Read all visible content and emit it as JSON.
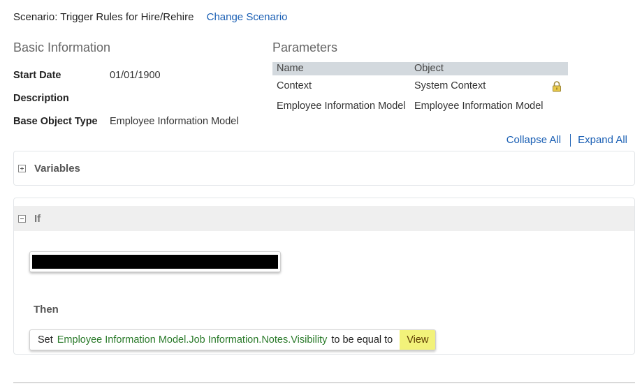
{
  "scenario": {
    "label": "Scenario: Trigger Rules for Hire/Rehire",
    "change_link": "Change Scenario"
  },
  "basic_info": {
    "title": "Basic Information",
    "rows": [
      {
        "label": "Start Date",
        "value": "01/01/1900"
      },
      {
        "label": "Description",
        "value": ""
      },
      {
        "label": "Base Object Type",
        "value": "Employee Information Model"
      }
    ]
  },
  "parameters": {
    "title": "Parameters",
    "headers": [
      "Name",
      "Object"
    ],
    "rows": [
      {
        "name": "Context",
        "object": "System Context",
        "locked": true
      },
      {
        "name": "Employee Information Model",
        "object": "Employee Information Model",
        "locked": false
      }
    ]
  },
  "expand_controls": {
    "collapse": "Collapse All",
    "expand": "Expand All"
  },
  "variables_panel": {
    "title": "Variables"
  },
  "if_panel": {
    "title": "If",
    "then_label": "Then",
    "set_statement": {
      "keyword": "Set",
      "field": "Employee Information Model.Job Information.Notes.Visibility",
      "operator": "to be equal to",
      "value": "View"
    }
  },
  "colors": {
    "link": "#1a5fb4",
    "field": "#2a7a2a",
    "value_highlight": "#f2f27a",
    "table_header": "#d3d9de"
  },
  "icons": {
    "lock": "lock-icon",
    "expand": "plus-box-icon",
    "collapse": "minus-box-icon"
  }
}
